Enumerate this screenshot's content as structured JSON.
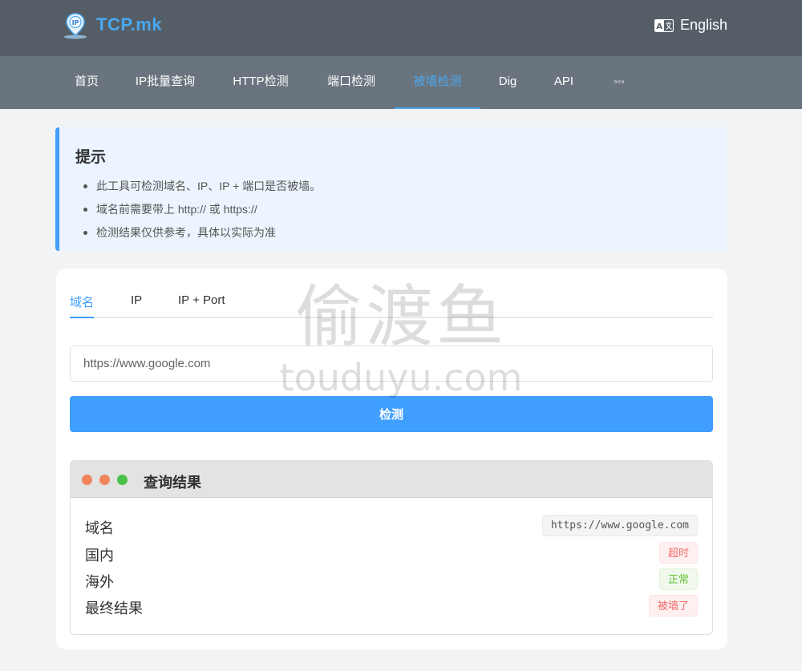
{
  "header": {
    "brand": "TCP.mk",
    "logo_icon": "ip-pin-logo-icon",
    "language_label": "English",
    "language_icon": "translate-icon"
  },
  "nav": {
    "items": [
      {
        "label": "首页"
      },
      {
        "label": "IP批量查询"
      },
      {
        "label": "HTTP检测"
      },
      {
        "label": "端口检测"
      },
      {
        "label": "被墙检测",
        "active": true
      },
      {
        "label": "Dig"
      },
      {
        "label": "API"
      },
      {
        "label": "◦◦◦"
      }
    ]
  },
  "tip": {
    "title": "提示",
    "items": [
      "此工具可检测域名、IP、IP + 端口是否被墙。",
      "域名前需要带上 http:// 或 https://",
      "检测结果仅供参考，具体以实际为准"
    ]
  },
  "checker": {
    "tabs": [
      {
        "label": "域名",
        "active": true
      },
      {
        "label": "IP"
      },
      {
        "label": "IP + Port"
      }
    ],
    "input_value": "https://www.google.com",
    "button_label": "检测"
  },
  "watermark": {
    "cn": "偷渡鱼",
    "en": "touduyu.com"
  },
  "result": {
    "title": "查询结果",
    "window_dots": [
      "#f0855b",
      "#f0855b",
      "#4cc14a"
    ],
    "rows": [
      {
        "label": "域名",
        "value": "https://www.google.com",
        "style": "mono"
      },
      {
        "label": "国内",
        "value": "超时",
        "style": "danger"
      },
      {
        "label": "海外",
        "value": "正常",
        "style": "success"
      },
      {
        "label": "最终结果",
        "value": "被墙了",
        "style": "danger"
      }
    ]
  },
  "colors": {
    "accent": "#409eff",
    "header_bg": "#555e66",
    "nav_bg": "#6a747e",
    "danger": "#f56c6c",
    "success": "#67c23a"
  }
}
